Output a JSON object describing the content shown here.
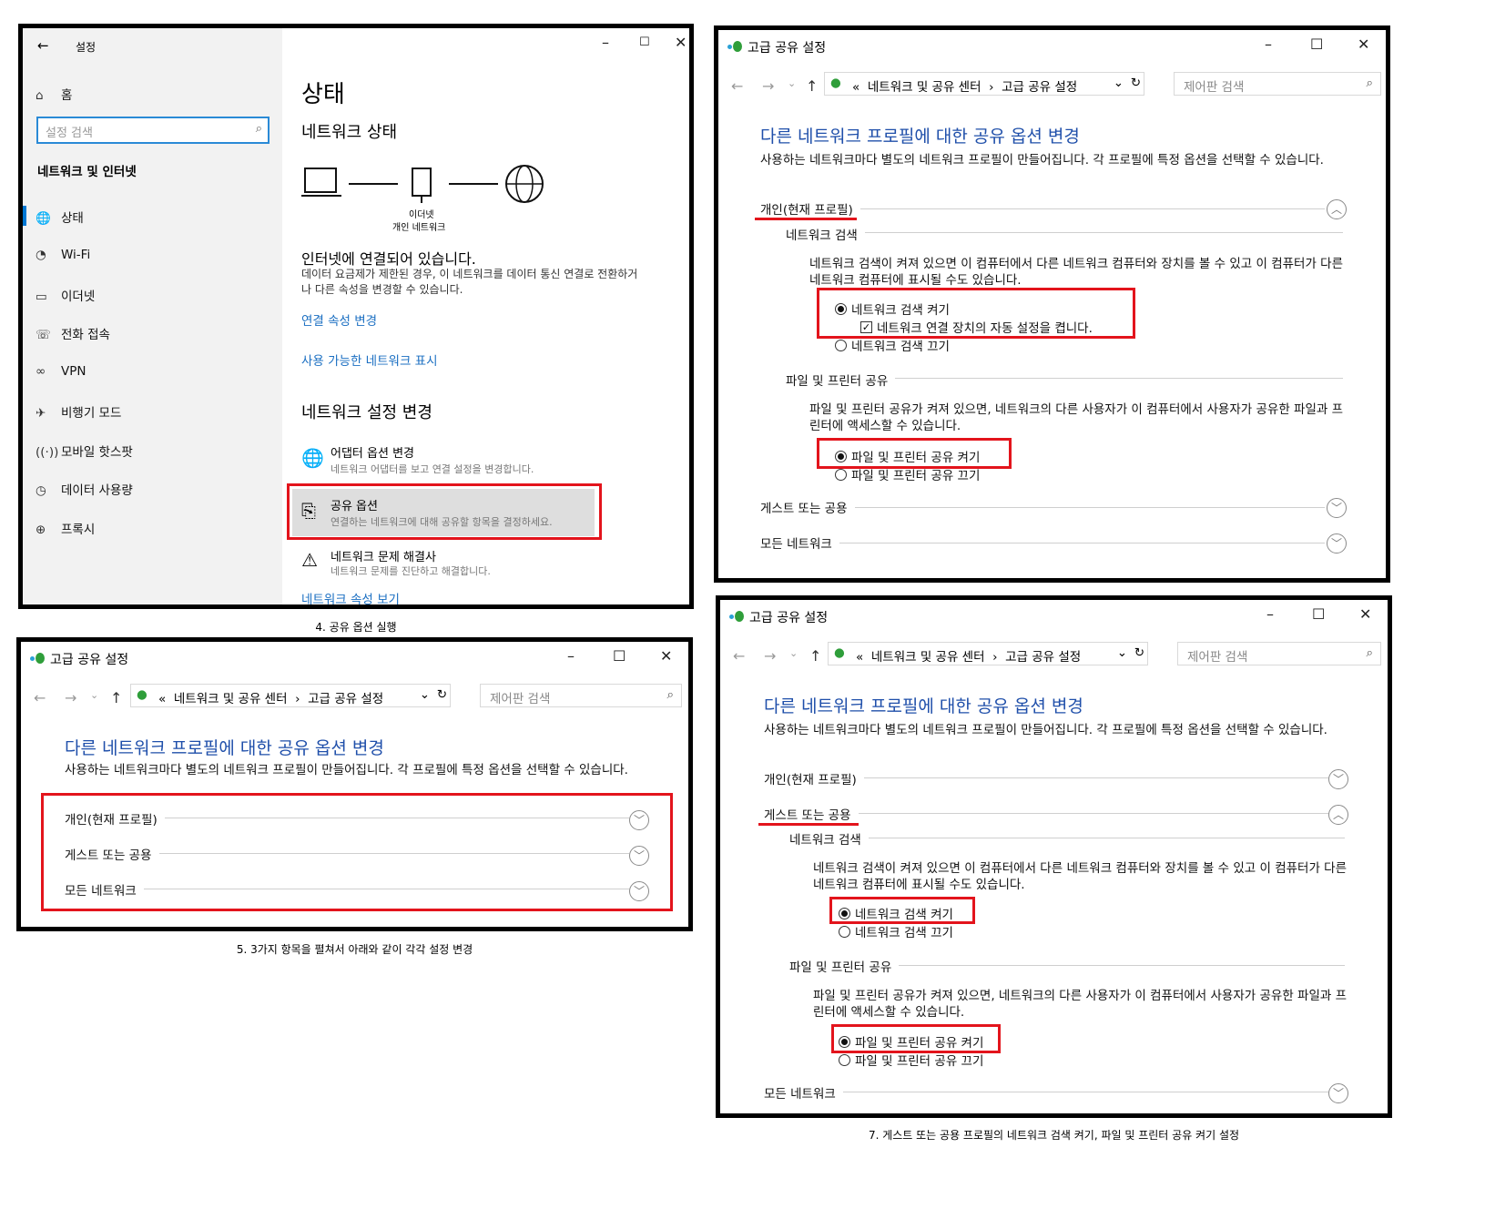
{
  "settings": {
    "title": "설정",
    "home": "홈",
    "search_placeholder": "설정 검색",
    "category": "네트워크 및 인터넷",
    "nav": [
      {
        "label": "상태",
        "icon": "globe-status-icon"
      },
      {
        "label": "Wi-Fi",
        "icon": "wifi-icon"
      },
      {
        "label": "이더넷",
        "icon": "ethernet-icon"
      },
      {
        "label": "전화 접속",
        "icon": "dialup-icon"
      },
      {
        "label": "VPN",
        "icon": "vpn-icon"
      },
      {
        "label": "비행기 모드",
        "icon": "airplane-icon"
      },
      {
        "label": "모바일 핫스팟",
        "icon": "hotspot-icon"
      },
      {
        "label": "데이터 사용량",
        "icon": "data-usage-icon"
      },
      {
        "label": "프록시",
        "icon": "proxy-icon"
      }
    ],
    "page_title": "상태",
    "network_status": "네트워크 상태",
    "diagram_label_1": "이더넷",
    "diagram_label_2": "개인 네트워크",
    "connected_title": "인터넷에 연결되어 있습니다.",
    "connected_desc": "데이터 요금제가 제한된 경우, 이 네트워크를 데이터 통신 연결로 전환하거나 다른 속성을 변경할 수 있습니다.",
    "link_change_props": "연결 속성 변경",
    "link_show_networks": "사용 가능한 네트워크 표시",
    "change_settings": "네트워크 설정 변경",
    "items": [
      {
        "title": "어댑터 옵션 변경",
        "desc": "네트워크 어댑터를 보고 연결 설정을 변경합니다."
      },
      {
        "title": "공유 옵션",
        "desc": "연결하는 네트워크에 대해 공유할 항목을 결정하세요."
      },
      {
        "title": "네트워크 문제 해결사",
        "desc": "네트워크 문제를 진단하고 해결합니다."
      }
    ],
    "link_view_props": "네트워크 속성 보기"
  },
  "captions": {
    "c4": "4. 공유 옵션 실행",
    "c5": "5. 3가지 항목을 펼쳐서 아래와 같이 각각 설정 변경",
    "c7": "7. 게스트 또는 공용 프로필의 네트워크 검색 켜기, 파일 및 프린터 공유 켜기 설정"
  },
  "sharing": {
    "title": "고급 공유 설정",
    "path_sep": "«",
    "crumb1": "네트워크 및 공유 센터",
    "crumb_arrow": "›",
    "crumb2": "고급 공유 설정",
    "search_placeholder": "제어판 검색",
    "heading": "다른 네트워크 프로필에 대한 공유 옵션 변경",
    "intro": "사용하는 네트워크마다 별도의 네트워크 프로필이 만들어집니다. 각 프로필에 특정 옵션을 선택할 수 있습니다.",
    "profile_private": "개인(현재 프로필)",
    "profile_guest": "게스트 또는 공용",
    "profile_all": "모든 네트워크",
    "discovery": "네트워크 검색",
    "discovery_desc": "네트워크 검색이 켜져 있으면 이 컴퓨터에서 다른 네트워크 컴퓨터와 장치를 볼 수 있고 이 컴퓨터가 다른 네트워크 컴퓨터에 표시될 수도 있습니다.",
    "discovery_on": "네트워크 검색 켜기",
    "auto_setup": "네트워크 연결 장치의 자동 설정을 켭니다.",
    "discovery_off": "네트워크 검색 끄기",
    "fps": "파일 및 프린터 공유",
    "fps_desc": "파일 및 프린터 공유가 켜져 있으면, 네트워크의 다른 사용자가 이 컴퓨터에서 사용자가 공유한 파일과 프린터에 액세스할 수 있습니다.",
    "fps_on": "파일 및 프린터 공유 켜기",
    "fps_off": "파일 및 프린터 공유 끄기"
  },
  "colors": {
    "highlight": "#e3141c",
    "link": "#1b6fc2",
    "heading": "#1f4faa"
  }
}
